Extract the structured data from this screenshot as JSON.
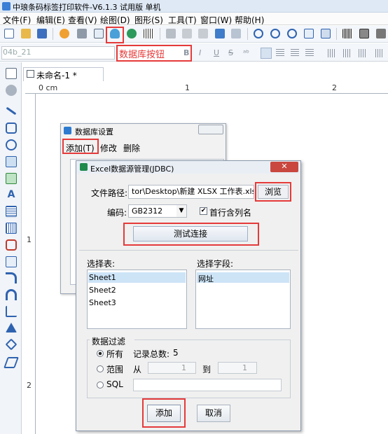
{
  "app": {
    "title": "中琅条码标签打印软件-V6.1.3 试用版 单机"
  },
  "menu": [
    "文件(F)",
    "编辑(E)",
    "查看(V)",
    "绘图(D)",
    "图形(S)",
    "工具(T)",
    "窗口(W)",
    "帮助(H)"
  ],
  "toolbar": {
    "font_name": "04b_21",
    "db_button_annotation": "数据库按钮"
  },
  "document": {
    "tab_title": "未命名-1 *"
  },
  "ruler": {
    "h0": "0 cm",
    "h1": "1",
    "h2": "2",
    "v1": "1",
    "v2": "2"
  },
  "db_dialog": {
    "title": "数据库设置",
    "menu_add": "添加(T)",
    "menu_edit": "修改",
    "menu_delete": "删除"
  },
  "excel_dialog": {
    "title": "Excel数据源管理(JDBC)",
    "close_label": "✕",
    "path_label": "文件路径:",
    "path_value": "tor\\Desktop\\新建 XLSX 工作表.xlsx",
    "browse_label": "浏览",
    "encoding_label": "编码:",
    "encoding_value": "GB2312",
    "first_row_label": "首行含列名",
    "first_row_checked": true,
    "test_button": "测试连接",
    "select_table_label": "选择表:",
    "tables": [
      "Sheet1",
      "Sheet2",
      "Sheet3"
    ],
    "select_field_label": "选择字段:",
    "fields": [
      "网址"
    ],
    "filter": {
      "title": "数据过滤",
      "all_label": "所有",
      "record_count_label": "记录总数:",
      "record_count": "5",
      "range_label": "范围",
      "from_label": "从",
      "to_label": "到",
      "from_value": "1",
      "to_value": "1",
      "sql_label": "SQL"
    },
    "add_button": "添加",
    "cancel_button": "取消"
  }
}
